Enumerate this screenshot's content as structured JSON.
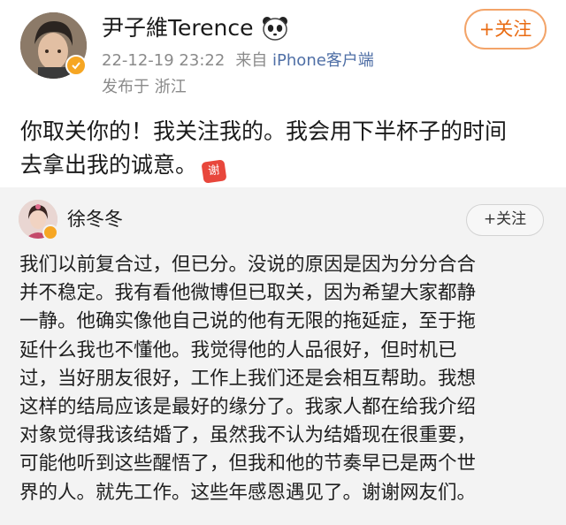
{
  "post": {
    "author_name": "尹子維Terence",
    "badge_icon": "panda-icon",
    "verified_icon": "verified-badge-icon",
    "timestamp": "22-12-19 23:22",
    "source_prefix": "来自",
    "source": "iPhone客户端",
    "location": "发布于 浙江",
    "follow_label": "+关注",
    "text_lines": [
      "你取关你的！我关注我的。我会用下半杯子的时间",
      "去拿出我的诚意。"
    ],
    "emoji_text": "谢"
  },
  "repost": {
    "author_name": "徐冬冬",
    "follow_label": "+关注",
    "text_lines": [
      "我们以前复合过，但已分。没说的原因是因为分分合合",
      "并不稳定。我有看他微博但已取关，因为希望大家都静",
      "一静。他确实像他自己说的他有无限的拖延症，至于拖",
      "延什么我也不懂他。我觉得他的人品很好，但时机已",
      "过，当好朋友很好，工作上我们还是会相互帮助。我想",
      "这样的结局应该是最好的缘分了。我家人都在给我介绍",
      "对象觉得我该结婚了，虽然我不认为结婚现在很重要，",
      "可能他听到这些醒悟了，但我和他的节奏早已是两个世",
      "界的人。就先工作。这些年感恩遇见了。谢谢网友们。"
    ]
  },
  "colors": {
    "accent_orange": "#e96b12",
    "link_blue": "#4f6fa6",
    "meta_gray": "#8a8a8a",
    "repost_bg": "#f3f3f3"
  }
}
